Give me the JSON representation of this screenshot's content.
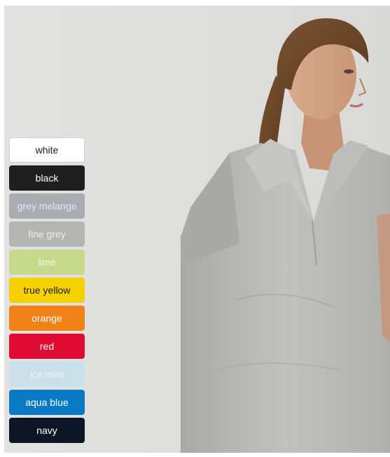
{
  "product": {
    "colors": [
      {
        "label": "white",
        "bg": "#ffffff",
        "fg": "#222222"
      },
      {
        "label": "black",
        "bg": "#1f1f1f",
        "fg": "#ffffff"
      },
      {
        "label": "grey melange",
        "bg": "#a9adb3",
        "fg": "#e3e5e8"
      },
      {
        "label": "fine grey",
        "bg": "#b4b4b2",
        "fg": "#eeeeee"
      },
      {
        "label": "lime",
        "bg": "#c7d98a",
        "fg": "#f3f7e2"
      },
      {
        "label": "true yellow",
        "bg": "#f6d100",
        "fg": "#1c1c1c"
      },
      {
        "label": "orange",
        "bg": "#f08218",
        "fg": "#ffffff"
      },
      {
        "label": "red",
        "bg": "#df0b33",
        "fg": "#ffffff"
      },
      {
        "label": "ice mint",
        "bg": "#c9dfea",
        "fg": "#eef6fa"
      },
      {
        "label": "aqua blue",
        "bg": "#0a79c4",
        "fg": "#ffffff"
      },
      {
        "label": "navy",
        "bg": "#0d1626",
        "fg": "#ffffff"
      }
    ]
  }
}
